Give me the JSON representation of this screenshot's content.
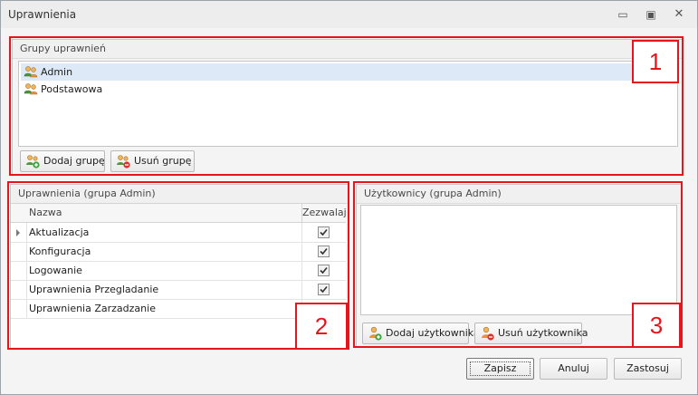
{
  "window": {
    "title": "Uprawnienia",
    "controls": {
      "minimize": "▭",
      "maximize": "▣",
      "close": "✕"
    }
  },
  "groups_panel": {
    "header": "Grupy uprawnień",
    "items": [
      {
        "label": "Admin",
        "selected": true,
        "icon": "user-group-icon"
      },
      {
        "label": "Podstawowa",
        "selected": false,
        "icon": "user-group-icon"
      }
    ],
    "add_button": "Dodaj grupę",
    "remove_button": "Usuń grupę"
  },
  "permissions_panel": {
    "header": "Uprawnienia (grupa Admin)",
    "columns": {
      "name": "Nazwa",
      "allow": "Zezwalaj"
    },
    "rows": [
      {
        "name": "Aktualizacja",
        "allowed": true,
        "current": true
      },
      {
        "name": "Konfiguracja",
        "allowed": true,
        "current": false
      },
      {
        "name": "Logowanie",
        "allowed": true,
        "current": false
      },
      {
        "name": "Uprawnienia Przegladanie",
        "allowed": true,
        "current": false
      },
      {
        "name": "Uprawnienia Zarzadzanie",
        "allowed": true,
        "current": false
      }
    ]
  },
  "users_panel": {
    "header": "Użytkownicy (grupa Admin)",
    "add_button": "Dodaj użytkownika",
    "remove_button": "Usuń użytkownika"
  },
  "footer": {
    "save": "Zapisz",
    "cancel": "Anuluj",
    "apply": "Zastosuj"
  },
  "annotations": {
    "color": "#e8141b",
    "labels": [
      "1",
      "2",
      "3"
    ]
  }
}
